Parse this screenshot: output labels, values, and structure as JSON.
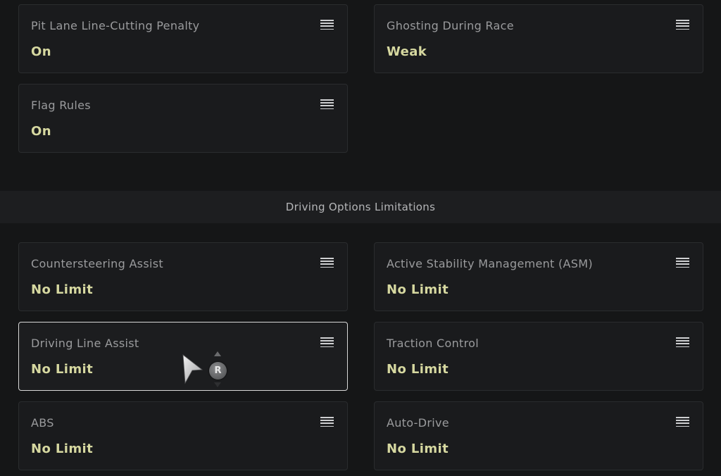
{
  "race_settings": [
    {
      "title": "Pit Lane Line-Cutting Penalty",
      "value": "On"
    },
    {
      "title": "Ghosting During Race",
      "value": "Weak"
    },
    {
      "title": "Flag Rules",
      "value": "On"
    }
  ],
  "section": {
    "title": "Driving Options Limitations"
  },
  "driving_options": [
    {
      "title": "Countersteering Assist",
      "value": "No Limit"
    },
    {
      "title": "Active Stability Management (ASM)",
      "value": "No Limit"
    },
    {
      "title": "Driving Line Assist",
      "value": "No Limit",
      "selected": true
    },
    {
      "title": "Traction Control",
      "value": "No Limit"
    },
    {
      "title": "ABS",
      "value": "No Limit"
    },
    {
      "title": "Auto-Drive",
      "value": "No Limit"
    }
  ],
  "cursor": {
    "badge_label": "R"
  },
  "colors": {
    "background": "#151617",
    "card": "#1a1b1d",
    "title_text": "#9a9b9d",
    "value_text": "#d6d8a0",
    "selected_border": "#d8d8d8"
  },
  "icons": {
    "menu": "menu-lines-icon",
    "cursor": "pointer-cursor-icon"
  }
}
